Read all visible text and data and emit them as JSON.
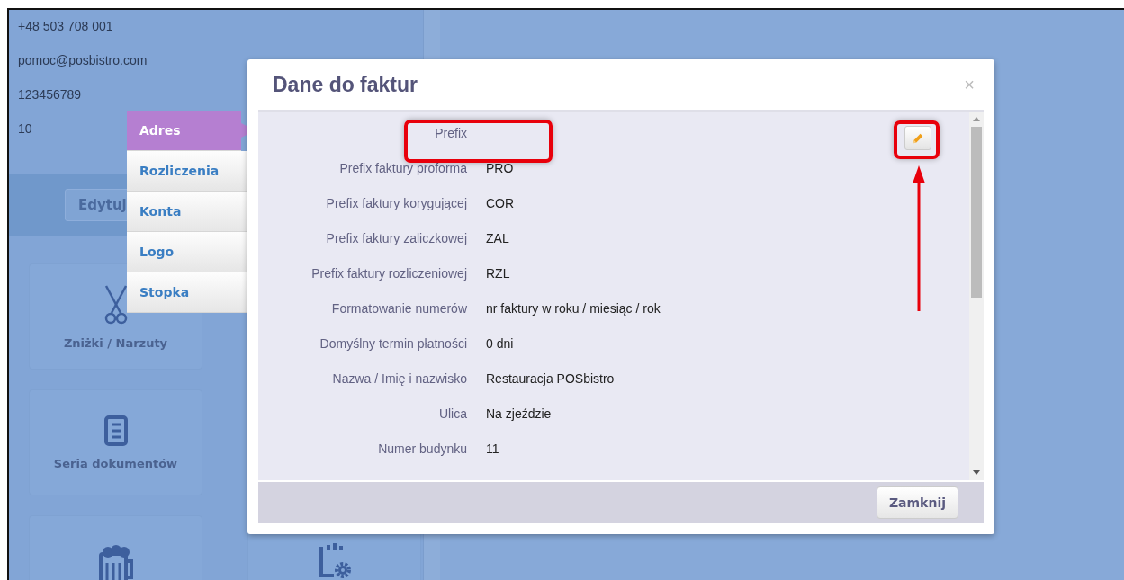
{
  "contact_lines": [
    "+48 503 708 001",
    "pomoc@posbistro.com",
    "123456789",
    "10"
  ],
  "edit_button": "Edytuj",
  "tiles": [
    {
      "kind": "scissors",
      "label": "Zniżki / Narzuty"
    },
    {
      "kind": "document",
      "label": "Seria dokumentów"
    },
    {
      "kind": "mug"
    },
    {
      "kind": "chart-gear"
    }
  ],
  "side_menu": [
    {
      "label": "Adres",
      "selected": true
    },
    {
      "label": "Rozliczenia",
      "selected": false
    },
    {
      "label": "Konta",
      "selected": false
    },
    {
      "label": "Logo",
      "selected": false
    },
    {
      "label": "Stopka",
      "selected": false
    }
  ],
  "modal": {
    "title": "Dane do faktur",
    "close": "×",
    "rows": [
      {
        "label": "Prefix"
      },
      {
        "label": "Prefix faktury proforma",
        "value": "PRO"
      },
      {
        "label": "Prefix faktury korygującej",
        "value": "COR"
      },
      {
        "label": "Prefix faktury zaliczkowej",
        "value": "ZAL"
      },
      {
        "label": "Prefix faktury rozliczeniowej",
        "value": "RZL"
      },
      {
        "label": "Formatowanie numerów",
        "value": "nr faktury w roku / miesiąc / rok"
      },
      {
        "label": "Domyślny termin płatności",
        "value": "0 dni"
      },
      {
        "label": "Nazwa / Imię i nazwisko",
        "value": "Restauracja POSbistro"
      },
      {
        "label": "Ulica",
        "value": "Na zjeździe"
      },
      {
        "label": "Numer budynku",
        "value": "11"
      }
    ],
    "footer_button": "Zamknij"
  }
}
